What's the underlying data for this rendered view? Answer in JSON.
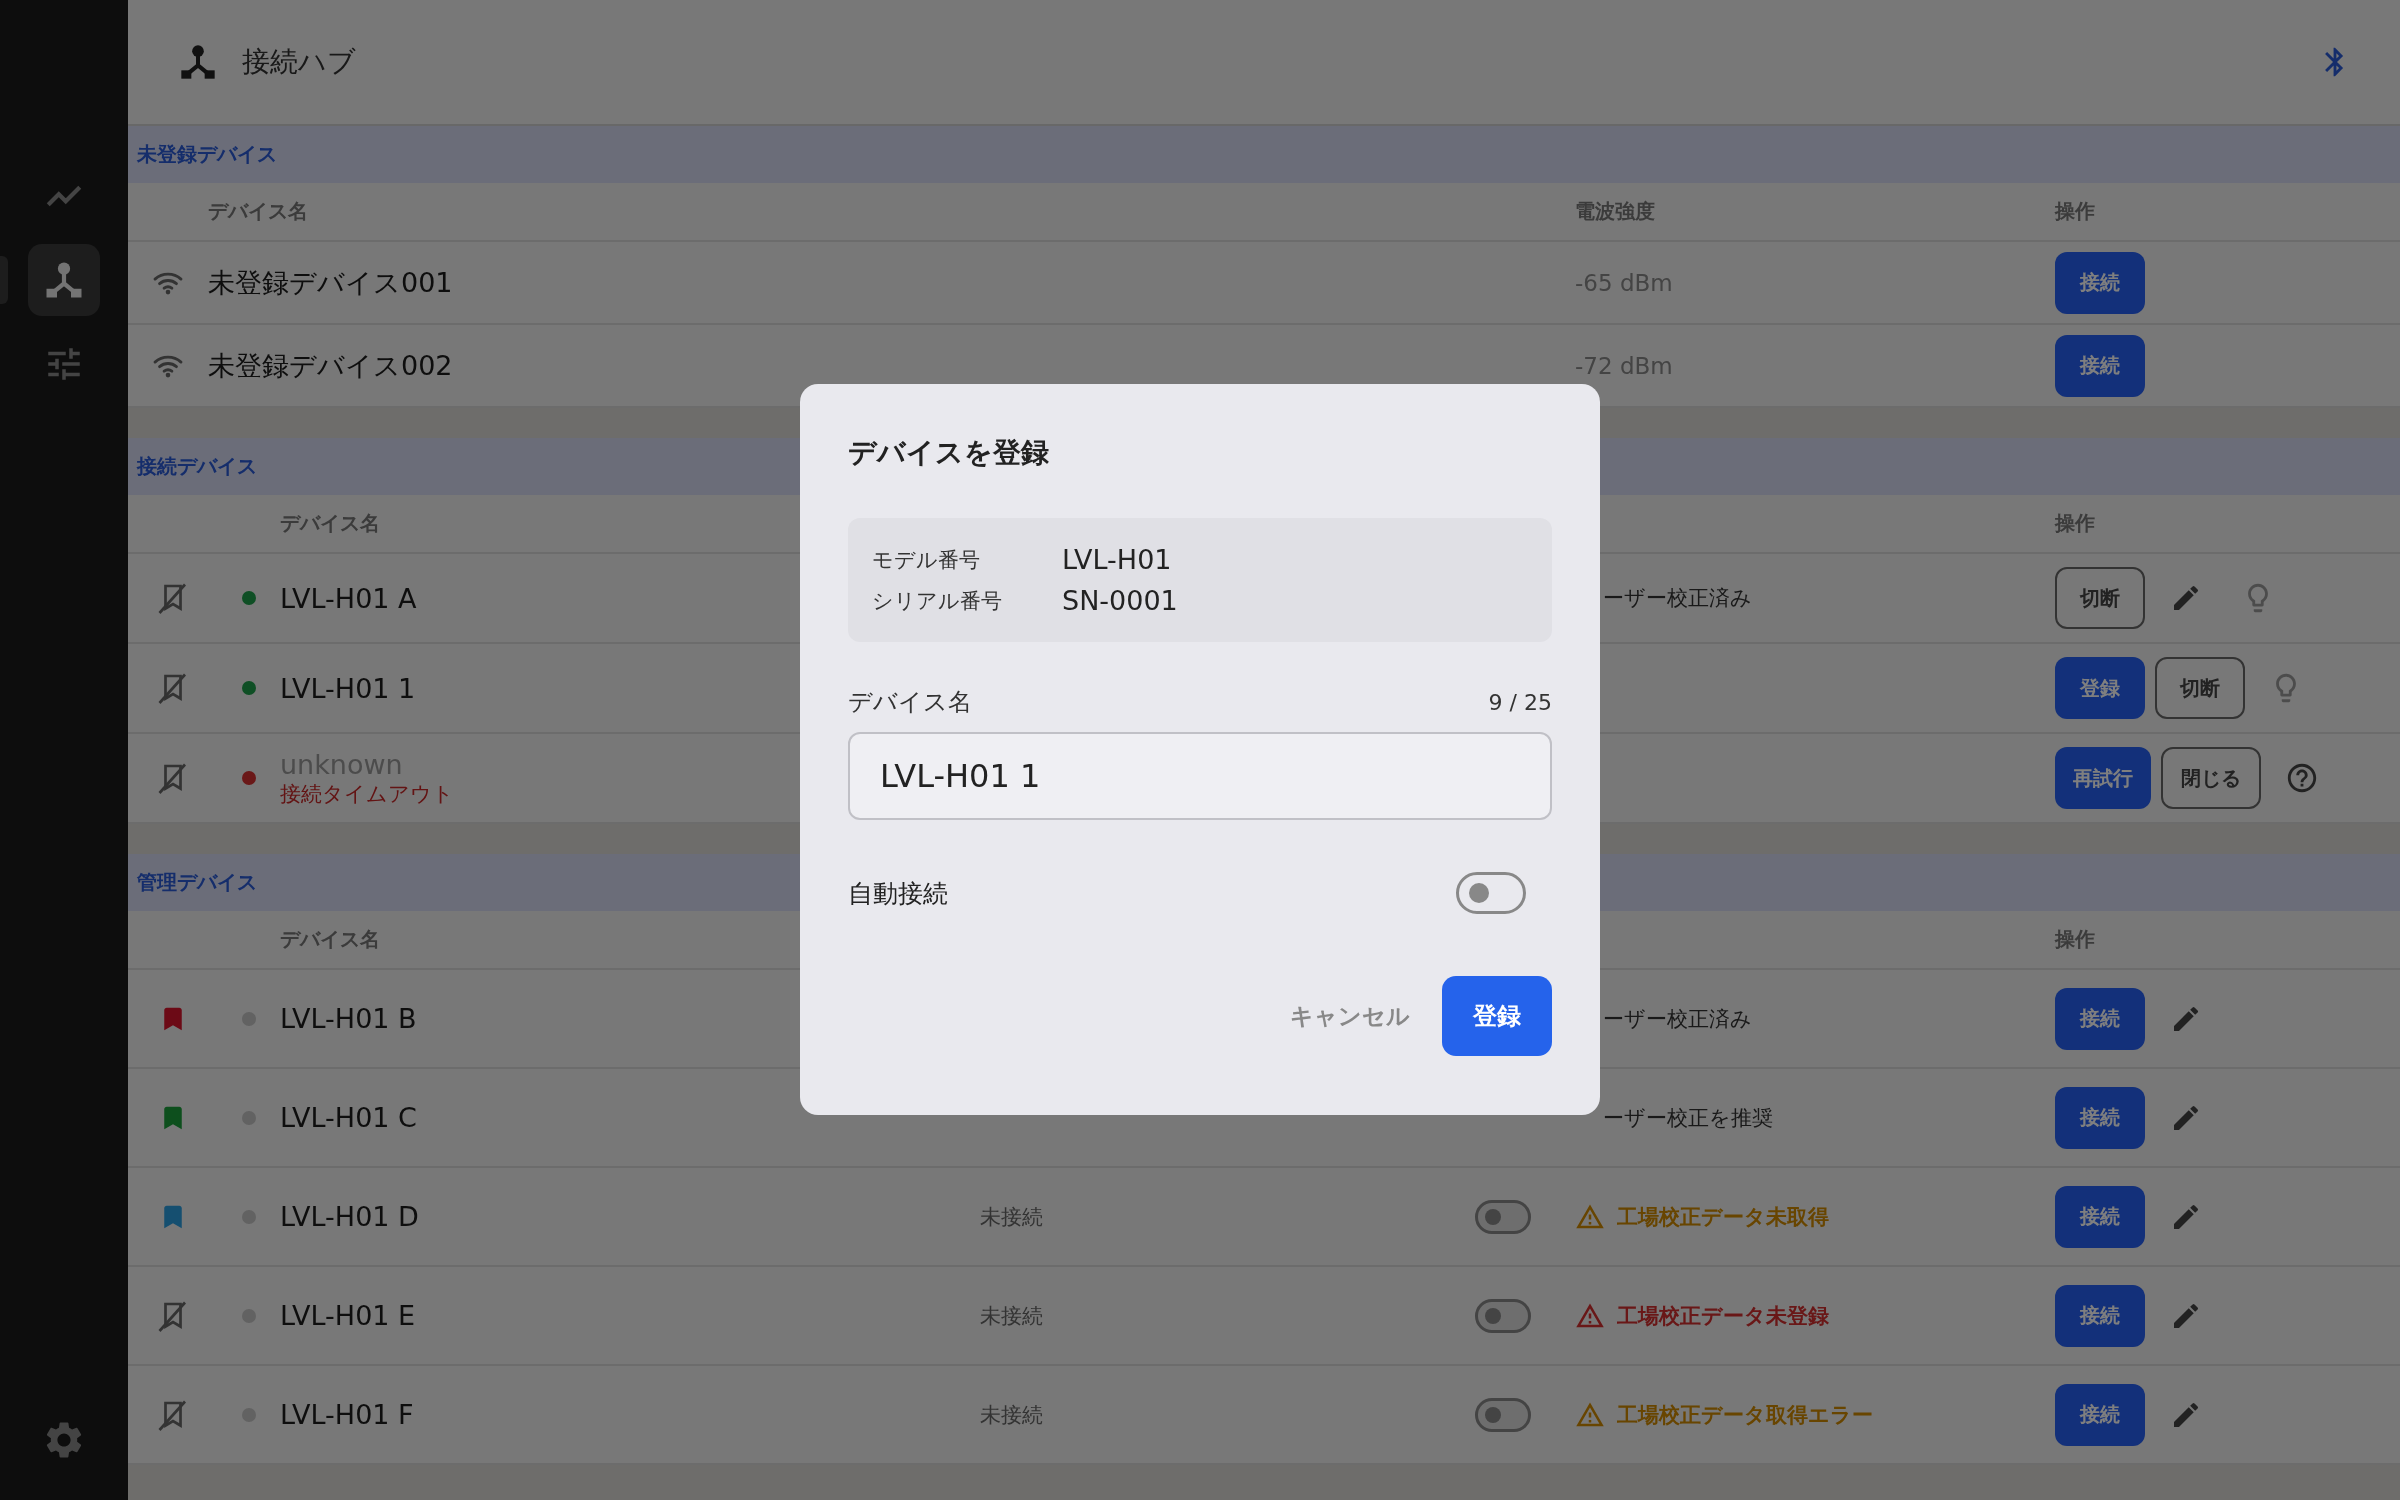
{
  "sidebar": {
    "items": [
      {
        "kind": "chart",
        "selected": false
      },
      {
        "kind": "hub",
        "selected": true
      },
      {
        "kind": "tune",
        "selected": false
      }
    ]
  },
  "header": {
    "title": "接続ハブ"
  },
  "sections": [
    {
      "kind": "discovery",
      "title": "未登録デバイス",
      "columns": [
        {
          "kind": "name",
          "label": "デバイス名"
        },
        {
          "kind": "note",
          "label": "電波強度"
        },
        {
          "kind": "actions",
          "label": "操作"
        }
      ],
      "rows": [
        {
          "name": "未登録デバイス001",
          "signal": "-65 dBm",
          "actions": [
            {
              "kind": "filled",
              "label": "接続"
            }
          ]
        },
        {
          "name": "未登録デバイス002",
          "signal": "-72 dBm",
          "actions": [
            {
              "kind": "filled",
              "label": "接続"
            }
          ]
        }
      ]
    },
    {
      "kind": "devices",
      "title": "接続デバイス",
      "columns": [
        {
          "kind": "name",
          "label": "デバイス名"
        },
        {
          "kind": "actions",
          "label": "操作"
        }
      ],
      "rows": [
        {
          "muted": false,
          "dot": {
            "color": "#0f4f25"
          },
          "name": "LVL-H01 A",
          "note": {
            "kind": "text",
            "text": "ーザー校正済み"
          },
          "actions": [
            {
              "kind": "outline",
              "label": "切断"
            },
            {
              "kind": "edit"
            },
            {
              "kind": "hint"
            }
          ]
        },
        {
          "muted": false,
          "dot": {
            "color": "#0f4f25"
          },
          "name": "LVL-H01 1",
          "actions": [
            {
              "kind": "filled",
              "label": "登録"
            },
            {
              "kind": "outline",
              "label": "切断"
            },
            {
              "kind": "hint"
            }
          ]
        },
        {
          "muted": true,
          "dot": {
            "color": "#6a1818"
          },
          "name": "unknown",
          "error": "接続タイムアウト",
          "actions": [
            {
              "kind": "filled",
              "label": "再試行"
            },
            {
              "kind": "outline",
              "label": "閉じる"
            },
            {
              "kind": "help"
            }
          ]
        }
      ]
    },
    {
      "kind": "devices",
      "title": "管理デバイス",
      "columns": [
        {
          "kind": "name",
          "label": "デバイス名"
        },
        {
          "kind": "actions",
          "label": "操作"
        }
      ],
      "rows": [
        {
          "muted": false,
          "tag": {
            "color": "#6c0a16"
          },
          "dot": {
            "color": "#626262"
          },
          "name": "LVL-H01 B",
          "note": {
            "kind": "text",
            "text": "ーザー校正済み"
          },
          "actions": [
            {
              "kind": "filled",
              "label": "接続"
            },
            {
              "kind": "edit"
            }
          ]
        },
        {
          "muted": false,
          "tag": {
            "color": "#0d4f1d"
          },
          "dot": {
            "color": "#626262"
          },
          "name": "LVL-H01 C",
          "note": {
            "kind": "text",
            "text": "ーザー校正を推奨"
          },
          "actions": [
            {
              "kind": "filled",
              "label": "接続"
            },
            {
              "kind": "edit"
            }
          ]
        },
        {
          "muted": false,
          "tag": {
            "color": "#154f70"
          },
          "dot": {
            "color": "#626262"
          },
          "name": "LVL-H01 D",
          "status": "未接続",
          "auto_connect": false,
          "note": {
            "kind": "warning",
            "text": "工場校正データ未取得"
          },
          "actions": [
            {
              "kind": "filled",
              "label": "接続"
            },
            {
              "kind": "edit"
            }
          ]
        },
        {
          "muted": false,
          "dot": {
            "color": "#626262"
          },
          "name": "LVL-H01 E",
          "status": "未接続",
          "auto_connect": false,
          "note": {
            "kind": "error",
            "text": "工場校正データ未登録"
          },
          "actions": [
            {
              "kind": "filled",
              "label": "接続"
            },
            {
              "kind": "edit"
            }
          ]
        },
        {
          "muted": false,
          "dot": {
            "color": "#626262"
          },
          "name": "LVL-H01 F",
          "status": "未接続",
          "auto_connect": false,
          "note": {
            "kind": "warning",
            "text": "工場校正データ取得エラー"
          },
          "actions": [
            {
              "kind": "filled",
              "label": "接続"
            },
            {
              "kind": "edit"
            }
          ]
        }
      ]
    }
  ],
  "dialog": {
    "title": "デバイスを登録",
    "info": [
      {
        "label": "モデル番号",
        "value": "LVL-H01"
      },
      {
        "label": "シリアル番号",
        "value": "SN-0001"
      }
    ],
    "field": {
      "label": "デバイス名",
      "counter": "9 / 25",
      "value": "LVL-H01 1"
    },
    "auto_connect": {
      "label": "自動接続",
      "on": false
    },
    "cancel": "キャンセル",
    "submit": "登録"
  }
}
